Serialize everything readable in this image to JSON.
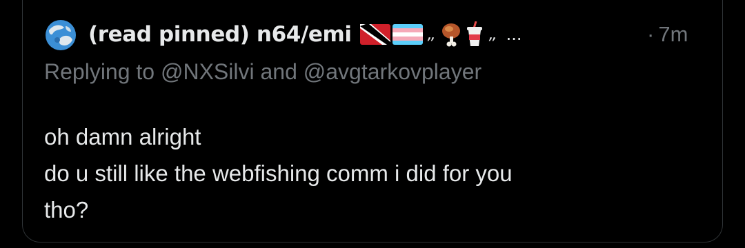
{
  "tweet": {
    "display_name": "(read pinned) n64/emi",
    "name_decoration_1": ",,",
    "name_decoration_2": ",,",
    "ellipsis": "...",
    "time_separator": "·",
    "timestamp": "7m",
    "replying_to": "Replying to @NXSilvi and @avgtarkovplayer",
    "body_lines": [
      "oh damn alright",
      "do u still like the webfishing comm i did for you",
      "tho?"
    ],
    "name_emojis": [
      "trinidad-flag-icon",
      "trans-flag-icon",
      "meat-on-bone-icon",
      "cup-with-straw-icon"
    ],
    "colors": {
      "background": "#000000",
      "primary_text": "#e7e9ea",
      "secondary_text": "#71767b",
      "border": "#2f3336"
    }
  }
}
